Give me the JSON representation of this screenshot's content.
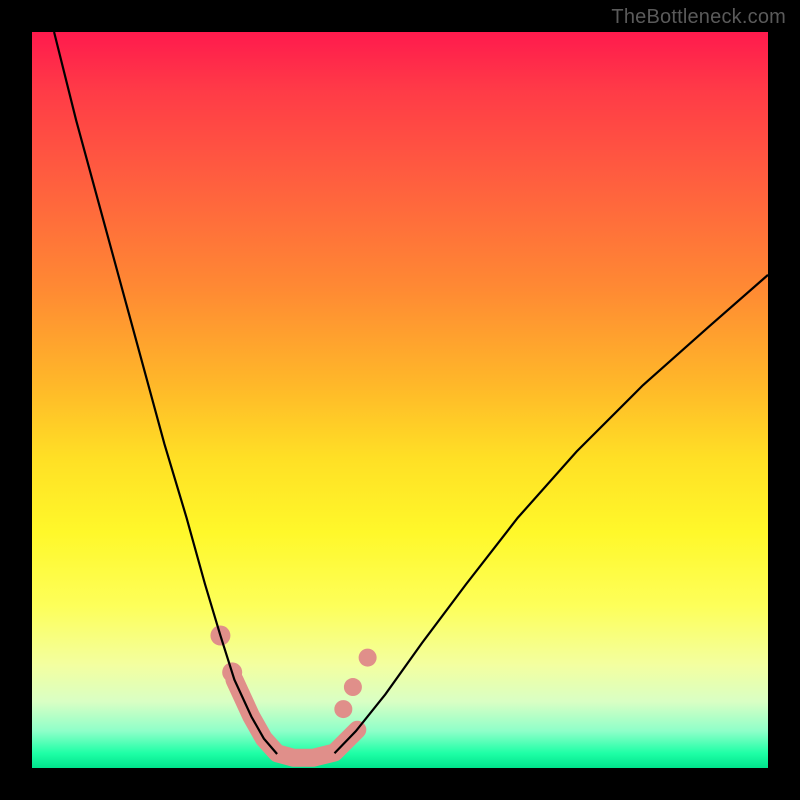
{
  "watermark": {
    "text": "TheBottleneck.com"
  },
  "chart_data": {
    "type": "line",
    "title": "",
    "xlabel": "",
    "ylabel": "",
    "xlim": [
      0,
      100
    ],
    "ylim": [
      0,
      100
    ],
    "grid": false,
    "legend": false,
    "background": {
      "type": "vertical-gradient",
      "stops": [
        {
          "pos": 0.0,
          "color": "#ff1a4d"
        },
        {
          "pos": 0.35,
          "color": "#ff8a33"
        },
        {
          "pos": 0.68,
          "color": "#fff82a"
        },
        {
          "pos": 0.95,
          "color": "#8effc9"
        },
        {
          "pos": 1.0,
          "color": "#00e38c"
        }
      ]
    },
    "series": [
      {
        "name": "left-curve",
        "color": "#000000",
        "width": 2.2,
        "x": [
          3,
          6,
          9,
          12,
          15,
          18,
          21,
          23.5,
          25.6,
          27.5,
          29.8,
          31.5,
          33.3
        ],
        "y": [
          100,
          88,
          77,
          66,
          55,
          44,
          34,
          25,
          18,
          12,
          7,
          4,
          1.9
        ]
      },
      {
        "name": "right-curve",
        "color": "#000000",
        "width": 2.2,
        "x": [
          41.1,
          44,
          48,
          53,
          59,
          66,
          74,
          83,
          92,
          100
        ],
        "y": [
          2.0,
          5,
          10,
          17,
          25,
          34,
          43,
          52,
          60,
          67
        ]
      },
      {
        "name": "valley-fat-segment",
        "color": "#e08f8a",
        "width": 18,
        "linecap": "round",
        "x": [
          27.5,
          29.8,
          31.5,
          33.3,
          35.5,
          38.2,
          41.1,
          44.2
        ],
        "y": [
          12,
          7,
          4,
          2.0,
          1.4,
          1.4,
          2.1,
          5.2
        ]
      }
    ],
    "markers": [
      {
        "name": "dot-left-1",
        "x": 25.6,
        "y": 18,
        "r": 10,
        "color": "#e08f8a"
      },
      {
        "name": "dot-left-2",
        "x": 27.2,
        "y": 13,
        "r": 10,
        "color": "#e08f8a"
      },
      {
        "name": "dot-right-1",
        "x": 42.3,
        "y": 8,
        "r": 9,
        "color": "#e08f8a"
      },
      {
        "name": "dot-right-2",
        "x": 43.6,
        "y": 11,
        "r": 9,
        "color": "#e08f8a"
      },
      {
        "name": "dot-right-3",
        "x": 45.6,
        "y": 15,
        "r": 9,
        "color": "#e08f8a"
      }
    ]
  }
}
